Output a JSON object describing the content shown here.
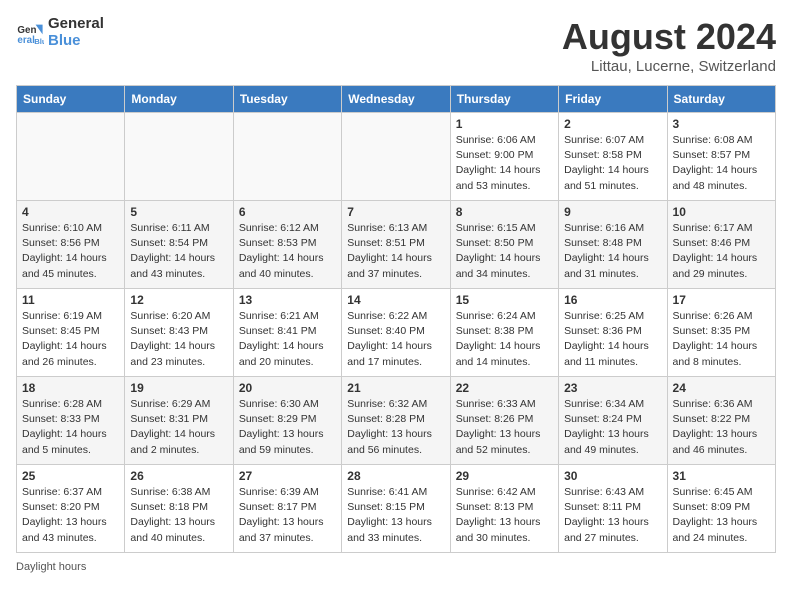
{
  "header": {
    "logo_general": "General",
    "logo_blue": "Blue",
    "month_year": "August 2024",
    "location": "Littau, Lucerne, Switzerland"
  },
  "days_of_week": [
    "Sunday",
    "Monday",
    "Tuesday",
    "Wednesday",
    "Thursday",
    "Friday",
    "Saturday"
  ],
  "weeks": [
    [
      {
        "num": "",
        "info": ""
      },
      {
        "num": "",
        "info": ""
      },
      {
        "num": "",
        "info": ""
      },
      {
        "num": "",
        "info": ""
      },
      {
        "num": "1",
        "info": "Sunrise: 6:06 AM\nSunset: 9:00 PM\nDaylight: 14 hours\nand 53 minutes."
      },
      {
        "num": "2",
        "info": "Sunrise: 6:07 AM\nSunset: 8:58 PM\nDaylight: 14 hours\nand 51 minutes."
      },
      {
        "num": "3",
        "info": "Sunrise: 6:08 AM\nSunset: 8:57 PM\nDaylight: 14 hours\nand 48 minutes."
      }
    ],
    [
      {
        "num": "4",
        "info": "Sunrise: 6:10 AM\nSunset: 8:56 PM\nDaylight: 14 hours\nand 45 minutes."
      },
      {
        "num": "5",
        "info": "Sunrise: 6:11 AM\nSunset: 8:54 PM\nDaylight: 14 hours\nand 43 minutes."
      },
      {
        "num": "6",
        "info": "Sunrise: 6:12 AM\nSunset: 8:53 PM\nDaylight: 14 hours\nand 40 minutes."
      },
      {
        "num": "7",
        "info": "Sunrise: 6:13 AM\nSunset: 8:51 PM\nDaylight: 14 hours\nand 37 minutes."
      },
      {
        "num": "8",
        "info": "Sunrise: 6:15 AM\nSunset: 8:50 PM\nDaylight: 14 hours\nand 34 minutes."
      },
      {
        "num": "9",
        "info": "Sunrise: 6:16 AM\nSunset: 8:48 PM\nDaylight: 14 hours\nand 31 minutes."
      },
      {
        "num": "10",
        "info": "Sunrise: 6:17 AM\nSunset: 8:46 PM\nDaylight: 14 hours\nand 29 minutes."
      }
    ],
    [
      {
        "num": "11",
        "info": "Sunrise: 6:19 AM\nSunset: 8:45 PM\nDaylight: 14 hours\nand 26 minutes."
      },
      {
        "num": "12",
        "info": "Sunrise: 6:20 AM\nSunset: 8:43 PM\nDaylight: 14 hours\nand 23 minutes."
      },
      {
        "num": "13",
        "info": "Sunrise: 6:21 AM\nSunset: 8:41 PM\nDaylight: 14 hours\nand 20 minutes."
      },
      {
        "num": "14",
        "info": "Sunrise: 6:22 AM\nSunset: 8:40 PM\nDaylight: 14 hours\nand 17 minutes."
      },
      {
        "num": "15",
        "info": "Sunrise: 6:24 AM\nSunset: 8:38 PM\nDaylight: 14 hours\nand 14 minutes."
      },
      {
        "num": "16",
        "info": "Sunrise: 6:25 AM\nSunset: 8:36 PM\nDaylight: 14 hours\nand 11 minutes."
      },
      {
        "num": "17",
        "info": "Sunrise: 6:26 AM\nSunset: 8:35 PM\nDaylight: 14 hours\nand 8 minutes."
      }
    ],
    [
      {
        "num": "18",
        "info": "Sunrise: 6:28 AM\nSunset: 8:33 PM\nDaylight: 14 hours\nand 5 minutes."
      },
      {
        "num": "19",
        "info": "Sunrise: 6:29 AM\nSunset: 8:31 PM\nDaylight: 14 hours\nand 2 minutes."
      },
      {
        "num": "20",
        "info": "Sunrise: 6:30 AM\nSunset: 8:29 PM\nDaylight: 13 hours\nand 59 minutes."
      },
      {
        "num": "21",
        "info": "Sunrise: 6:32 AM\nSunset: 8:28 PM\nDaylight: 13 hours\nand 56 minutes."
      },
      {
        "num": "22",
        "info": "Sunrise: 6:33 AM\nSunset: 8:26 PM\nDaylight: 13 hours\nand 52 minutes."
      },
      {
        "num": "23",
        "info": "Sunrise: 6:34 AM\nSunset: 8:24 PM\nDaylight: 13 hours\nand 49 minutes."
      },
      {
        "num": "24",
        "info": "Sunrise: 6:36 AM\nSunset: 8:22 PM\nDaylight: 13 hours\nand 46 minutes."
      }
    ],
    [
      {
        "num": "25",
        "info": "Sunrise: 6:37 AM\nSunset: 8:20 PM\nDaylight: 13 hours\nand 43 minutes."
      },
      {
        "num": "26",
        "info": "Sunrise: 6:38 AM\nSunset: 8:18 PM\nDaylight: 13 hours\nand 40 minutes."
      },
      {
        "num": "27",
        "info": "Sunrise: 6:39 AM\nSunset: 8:17 PM\nDaylight: 13 hours\nand 37 minutes."
      },
      {
        "num": "28",
        "info": "Sunrise: 6:41 AM\nSunset: 8:15 PM\nDaylight: 13 hours\nand 33 minutes."
      },
      {
        "num": "29",
        "info": "Sunrise: 6:42 AM\nSunset: 8:13 PM\nDaylight: 13 hours\nand 30 minutes."
      },
      {
        "num": "30",
        "info": "Sunrise: 6:43 AM\nSunset: 8:11 PM\nDaylight: 13 hours\nand 27 minutes."
      },
      {
        "num": "31",
        "info": "Sunrise: 6:45 AM\nSunset: 8:09 PM\nDaylight: 13 hours\nand 24 minutes."
      }
    ]
  ],
  "footer": {
    "note": "Daylight hours"
  }
}
